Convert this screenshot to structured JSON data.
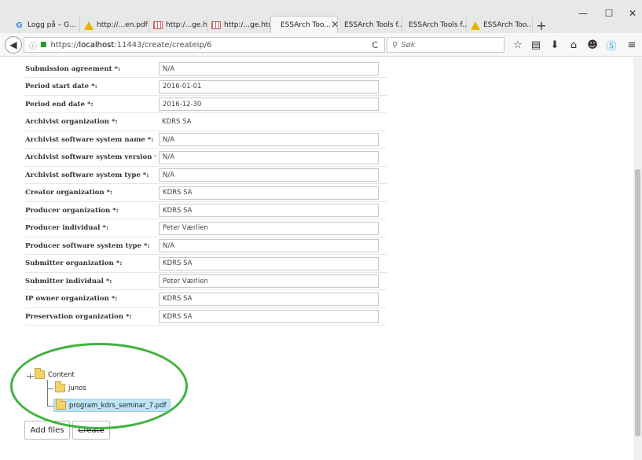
{
  "tabs": [
    {
      "label": "Logg på – G...",
      "icon": "google-icon"
    },
    {
      "label": "http://...en.pdf",
      "icon": "warning-icon"
    },
    {
      "label": "http:/...ge.htm",
      "icon": "grid-icon"
    },
    {
      "label": "http:/...ge.htm",
      "icon": "grid-icon"
    },
    {
      "label": "ESSArch Too...",
      "icon": "",
      "close": "×"
    },
    {
      "label": "ESSArch Tools f...",
      "icon": ""
    },
    {
      "label": "ESSArch Tools f...",
      "icon": ""
    },
    {
      "label": "ESSArch Too...",
      "icon": "warning-icon"
    }
  ],
  "window_controls": {
    "minimize": "—",
    "maximize": "☐",
    "close": "✕"
  },
  "newtab": "+",
  "nav": {
    "url_prefix": "https://",
    "url_host": "localhost",
    "url_rest": ":11443/create/createip/6",
    "reload": "C",
    "search_placeholder": "Søk"
  },
  "form": {
    "rows": [
      {
        "label": "Submission agreement *:",
        "value": "N/A",
        "type": "input"
      },
      {
        "label": "Period start date *:",
        "value": "2016-01-01",
        "type": "input"
      },
      {
        "label": "Period end date *:",
        "value": "2016-12-30",
        "type": "input"
      },
      {
        "label": "Archivist organization *:",
        "value": "KDRS SA",
        "type": "static"
      },
      {
        "label": "Archivist software system name *:",
        "value": "N/A",
        "type": "input"
      },
      {
        "label": "Archivist software system version *:",
        "value": "N/A",
        "type": "input"
      },
      {
        "label": "Archivist software system type *:",
        "value": "N/A",
        "type": "input"
      },
      {
        "label": "Creator organization *:",
        "value": "KDRS SA",
        "type": "input"
      },
      {
        "label": "Producer organization *:",
        "value": "KDRS SA",
        "type": "input"
      },
      {
        "label": "Producer individual *:",
        "value": "Peter Værlien",
        "type": "input"
      },
      {
        "label": "Producer software system type *:",
        "value": "N/A",
        "type": "input"
      },
      {
        "label": "Submitter organization *:",
        "value": "KDRS SA",
        "type": "input"
      },
      {
        "label": "Submitter individual *:",
        "value": "Peter Værlien",
        "type": "input"
      },
      {
        "label": "IP owner organization *:",
        "value": "KDRS SA",
        "type": "input"
      },
      {
        "label": "Preservation organization *:",
        "value": "KDRS SA",
        "type": "input"
      }
    ]
  },
  "tree": {
    "root": "Content",
    "children": [
      "junos",
      "program_kdrs_seminar_7.pdf"
    ]
  },
  "buttons": {
    "add_files": "Add files",
    "create": "Create"
  }
}
